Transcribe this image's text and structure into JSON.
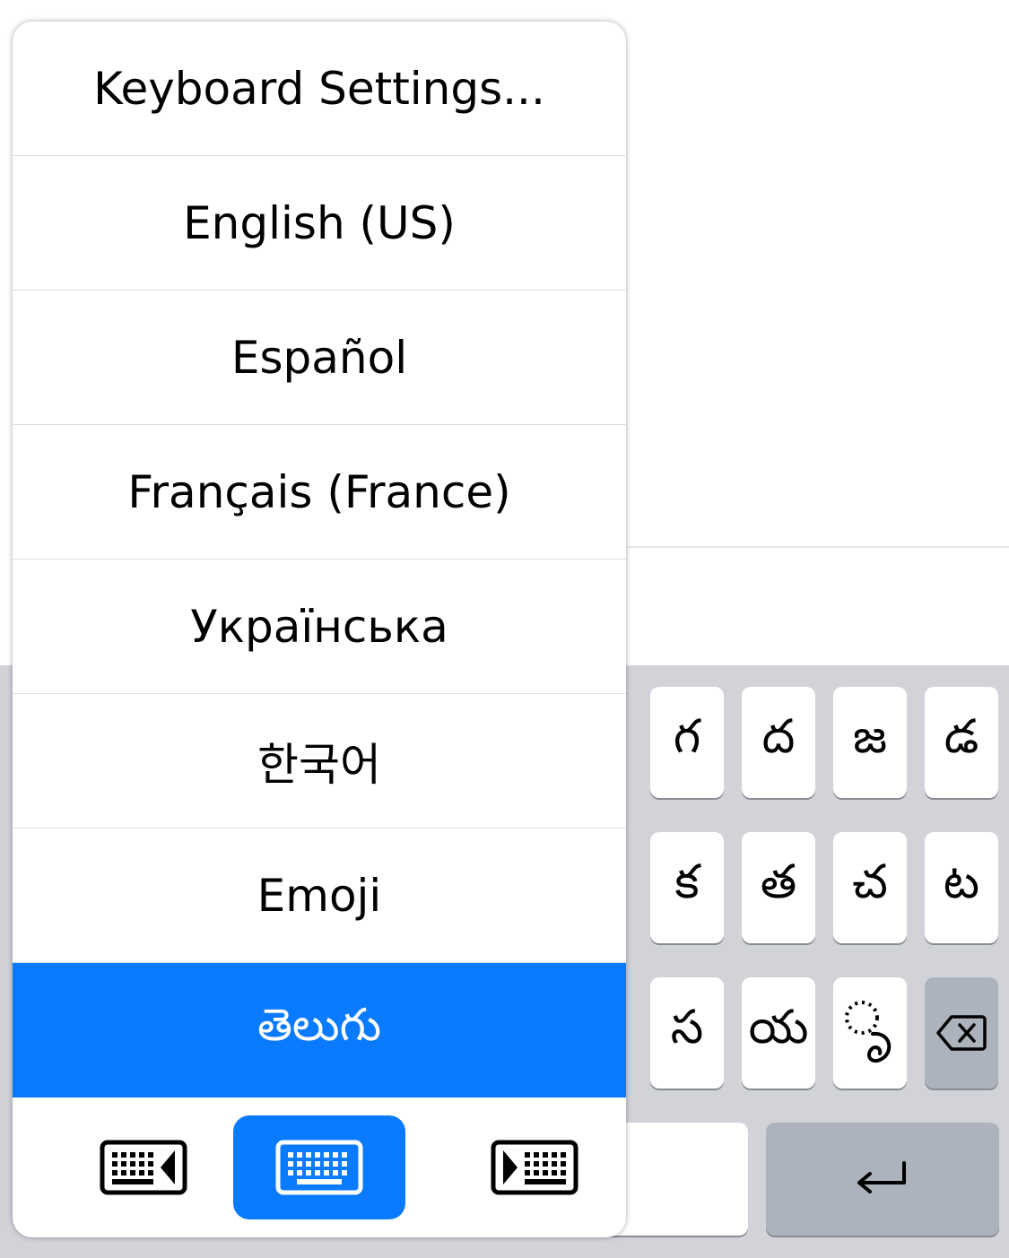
{
  "menu": {
    "items": [
      {
        "label": "Keyboard Settings..."
      },
      {
        "label": "English (US)"
      },
      {
        "label": "Español"
      },
      {
        "label": "Français (France)"
      },
      {
        "label": "Українська"
      },
      {
        "label": "한국어"
      },
      {
        "label": "Emoji"
      },
      {
        "label": "తెలుగు",
        "selected": true
      }
    ],
    "layout_options": [
      {
        "icon": "keyboard-left-icon",
        "active": false
      },
      {
        "icon": "keyboard-center-icon",
        "active": true
      },
      {
        "icon": "keyboard-right-icon",
        "active": false
      }
    ]
  },
  "keyboard": {
    "row1": [
      "గ",
      "ద",
      "జ",
      "డ"
    ],
    "row2": [
      "క",
      "త",
      "చ",
      "ట"
    ],
    "row3": [
      "స",
      "య",
      "ృ"
    ],
    "delete_icon": "delete-icon",
    "return_icon": "return-icon"
  },
  "colors": {
    "accent": "#0a7aff",
    "keyboard_bg": "#d1d3d9",
    "dark_key": "#adb3bc"
  }
}
